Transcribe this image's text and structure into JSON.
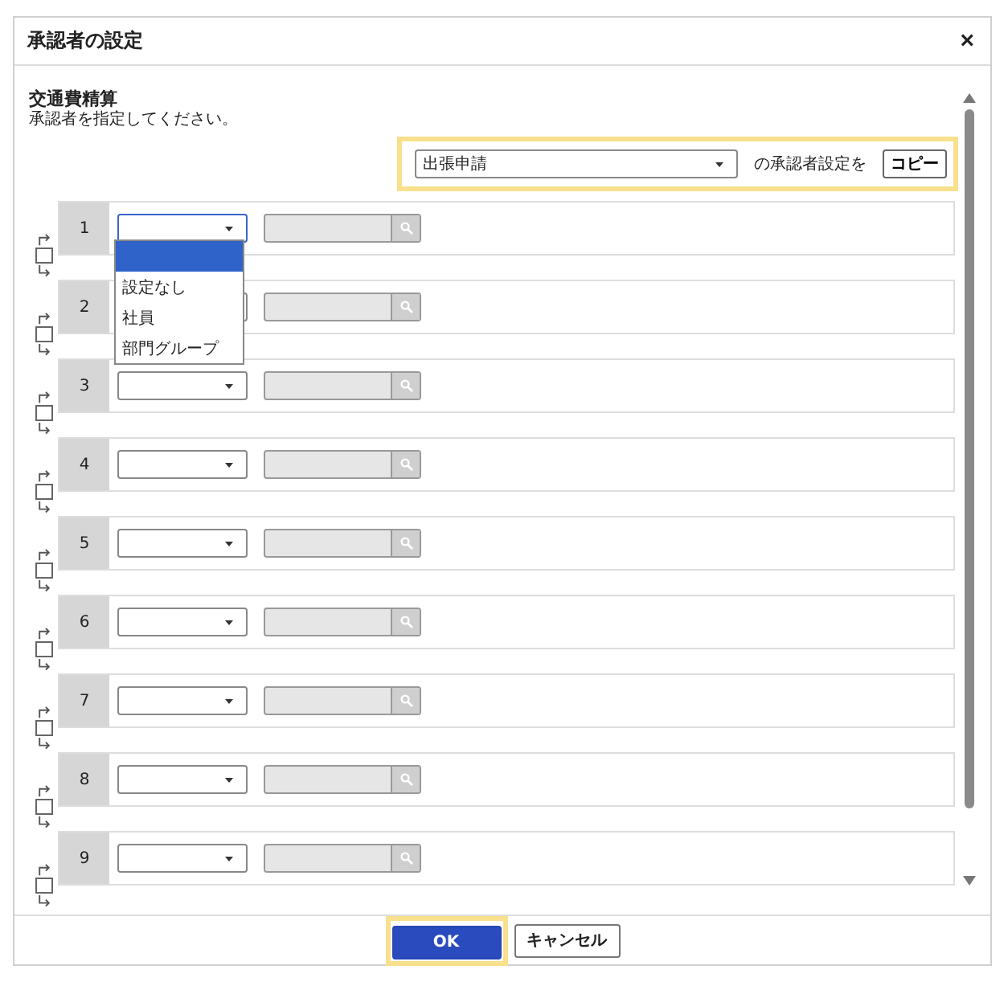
{
  "dialog": {
    "title": "承認者の設定",
    "close": "×"
  },
  "section": {
    "title": "交通費精算",
    "instruction": "承認者を指定してください。"
  },
  "copy": {
    "source": "出張申請",
    "label": "の承認者設定を",
    "button": "コピー"
  },
  "steps": [
    {
      "number": "1",
      "checked": false,
      "menu": [
        {
          "selected": true
        },
        {
          "label": "設定なし",
          "selected": false
        },
        {
          "label": "社員",
          "selected": false
        },
        {
          "label": "部門グループ",
          "selected": false
        }
      ]
    },
    {
      "number": "2",
      "checked": false
    },
    {
      "number": "3",
      "checked": false
    },
    {
      "number": "4",
      "checked": false
    },
    {
      "number": "5",
      "checked": false
    },
    {
      "number": "6",
      "checked": false
    },
    {
      "number": "7",
      "checked": false
    },
    {
      "number": "8",
      "checked": false
    },
    {
      "number": "9",
      "checked": false
    }
  ],
  "footer": {
    "buttons": [
      {
        "label": "OK",
        "kind": "primary"
      },
      {
        "label": "キャンセル",
        "kind": "secondary"
      }
    ]
  }
}
